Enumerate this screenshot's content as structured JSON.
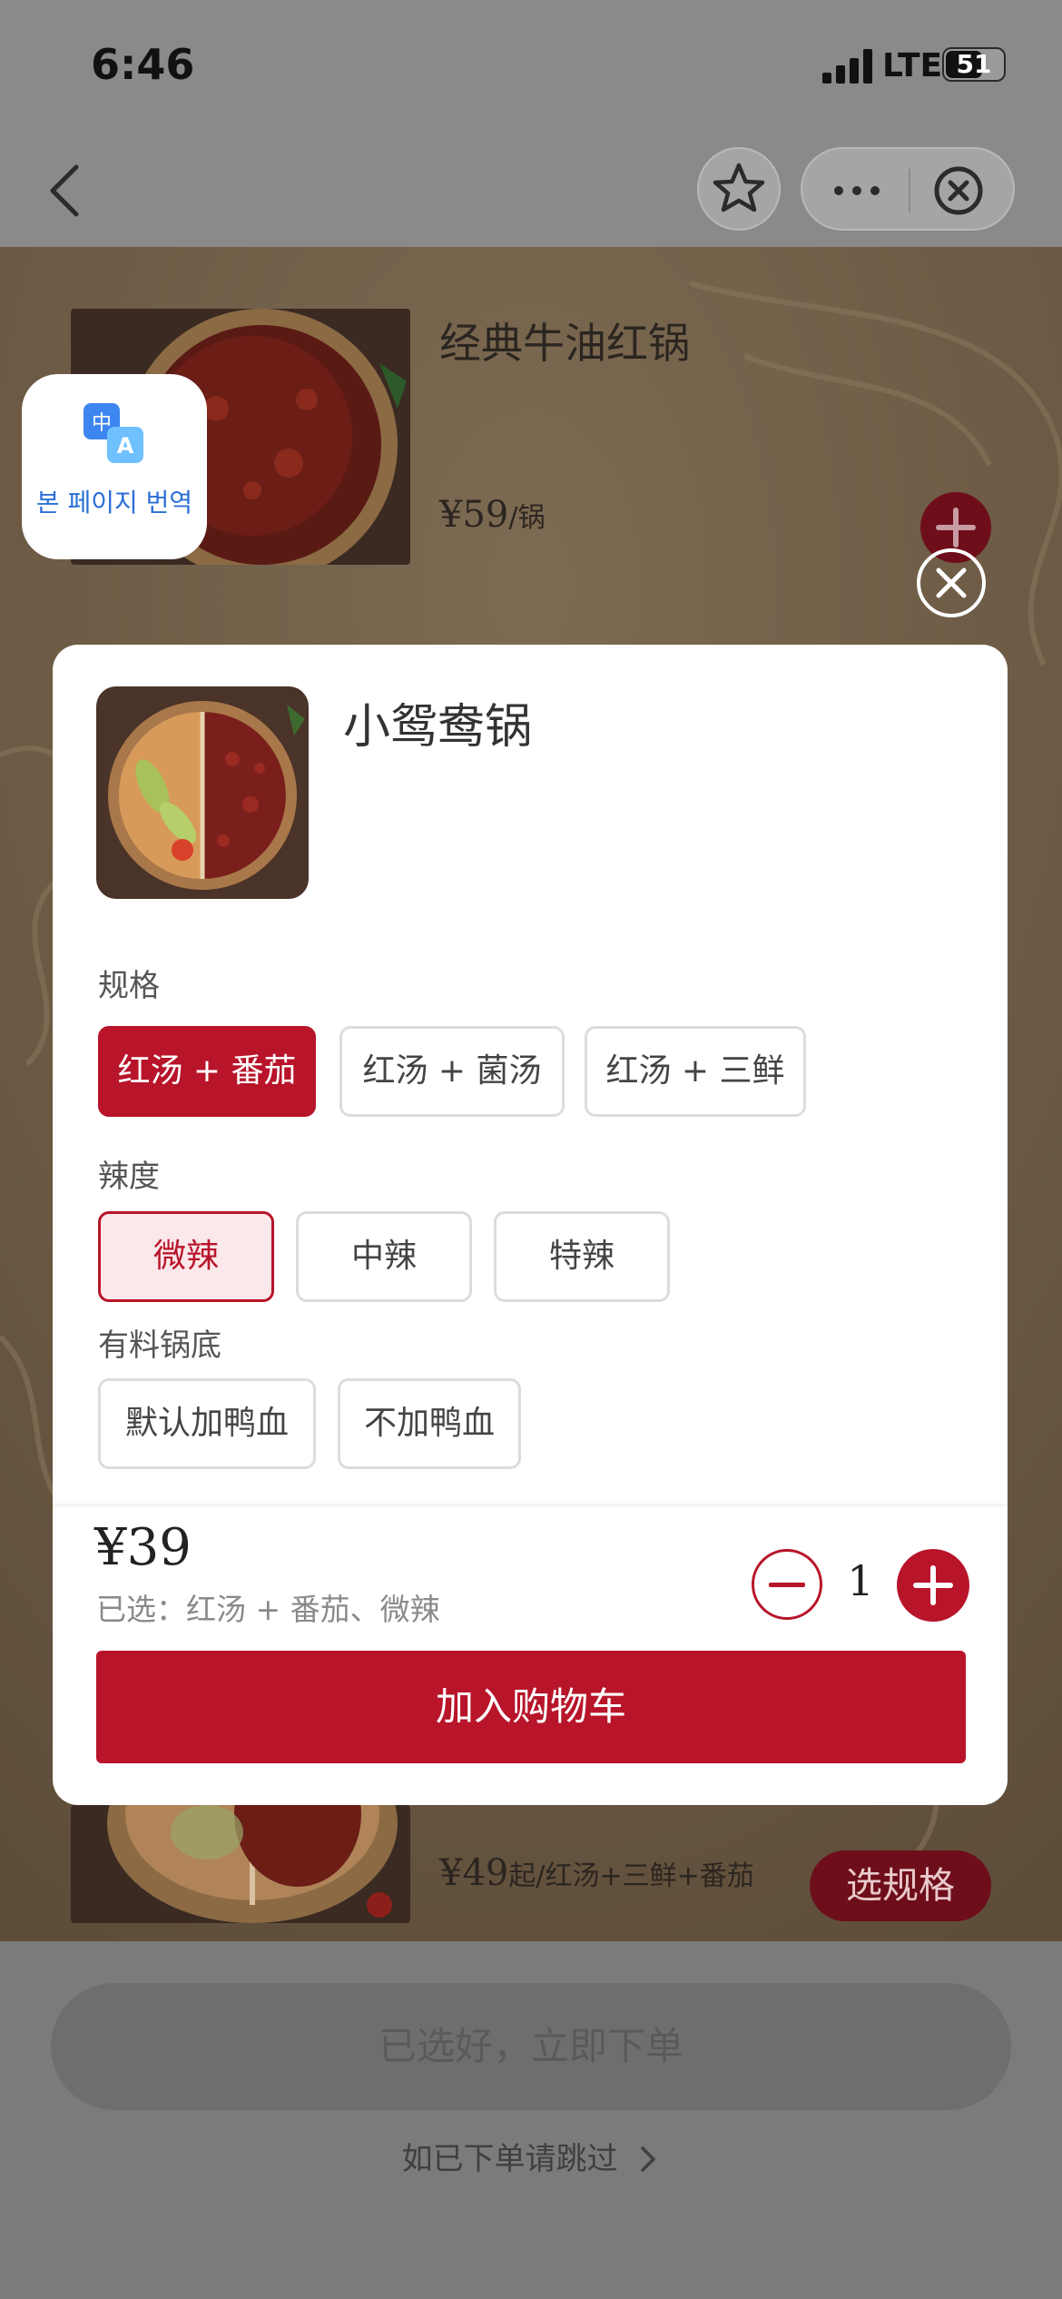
{
  "status_bar": {
    "time": "6:46",
    "network": "LTE",
    "battery": "51"
  },
  "nav": {
    "back_icon": "chevron-left-icon",
    "favorite_icon": "star-icon",
    "more_icon": "more-dots-icon",
    "close_icon": "close-circle-icon"
  },
  "translate_widget": {
    "icon": "translate-icon",
    "label": "본 페이지 번역"
  },
  "menu": {
    "items": [
      {
        "name": "经典牛油红锅",
        "price_symbol": "¥",
        "price": "59",
        "unit": "/锅"
      },
      {
        "name": "",
        "price_symbol": "¥",
        "price": "49",
        "unit": "起/红汤+三鲜+番茄",
        "action_label": "选规格"
      }
    ]
  },
  "modal": {
    "title": "小鸳鸯锅",
    "sections": [
      {
        "label": "规格",
        "options": [
          "红汤 + 番茄",
          "红汤 + 菌汤",
          "红汤 + 三鲜"
        ],
        "selected": "红汤 + 番茄"
      },
      {
        "label": "辣度",
        "options": [
          "微辣",
          "中辣",
          "特辣"
        ],
        "selected": "微辣"
      },
      {
        "label": "有料锅底",
        "options": [
          "默认加鸭血",
          "不加鸭血"
        ],
        "selected": ""
      }
    ],
    "price": "¥39",
    "selected_summary": "已选：红汤 + 番茄、微辣",
    "quantity": "1",
    "add_to_cart_label": "加入购物车"
  },
  "bottom": {
    "order_button": "已选好，立即下单",
    "skip_link": "如已下单请跳过"
  },
  "colors": {
    "accent": "#b8142a",
    "accent_light": "#fbe8ea",
    "overlay_bg": "#6b5a44"
  }
}
